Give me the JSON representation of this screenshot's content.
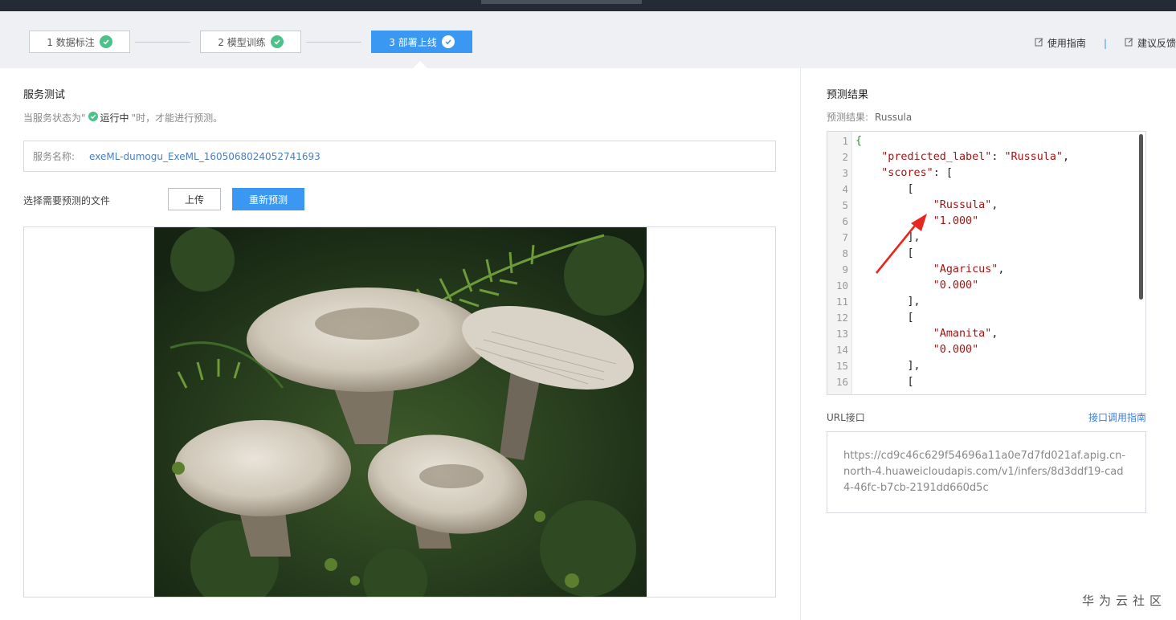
{
  "steps": [
    {
      "label": "1 数据标注",
      "active": false
    },
    {
      "label": "2 模型训练",
      "active": false
    },
    {
      "label": "3 部署上线",
      "active": true
    }
  ],
  "top_links": {
    "guide": "使用指南",
    "separator": "|",
    "feedback": "建议反馈"
  },
  "left": {
    "title": "服务测试",
    "hint_prefix": "当服务状态为\"",
    "hint_status": "运行中",
    "hint_suffix": "\"时，才能进行预测。",
    "service_name_label": "服务名称:",
    "service_name_value": "exeML-dumogu_ExeML_1605068024052741693",
    "pick_label": "选择需要预测的文件",
    "upload_button": "上传",
    "repredict_button": "重新预测"
  },
  "right": {
    "title": "预测结果",
    "result_label": "预测结果:",
    "result_value": "Russula",
    "code_lines": [
      {
        "n": "1",
        "parts": [
          {
            "t": "{",
            "c": "brace"
          }
        ]
      },
      {
        "n": "2",
        "parts": [
          {
            "t": "    ",
            "c": ""
          },
          {
            "t": "\"predicted_label\"",
            "c": "str"
          },
          {
            "t": ": ",
            "c": ""
          },
          {
            "t": "\"Russula\"",
            "c": "str"
          },
          {
            "t": ",",
            "c": ""
          }
        ]
      },
      {
        "n": "3",
        "parts": [
          {
            "t": "    ",
            "c": ""
          },
          {
            "t": "\"scores\"",
            "c": "str"
          },
          {
            "t": ": [",
            "c": ""
          }
        ]
      },
      {
        "n": "4",
        "parts": [
          {
            "t": "        [",
            "c": ""
          }
        ]
      },
      {
        "n": "5",
        "parts": [
          {
            "t": "            ",
            "c": ""
          },
          {
            "t": "\"Russula\"",
            "c": "str"
          },
          {
            "t": ",",
            "c": ""
          }
        ]
      },
      {
        "n": "6",
        "parts": [
          {
            "t": "            ",
            "c": ""
          },
          {
            "t": "\"1.000\"",
            "c": "str"
          }
        ]
      },
      {
        "n": "7",
        "parts": [
          {
            "t": "        ],",
            "c": ""
          }
        ]
      },
      {
        "n": "8",
        "parts": [
          {
            "t": "        [",
            "c": ""
          }
        ]
      },
      {
        "n": "9",
        "parts": [
          {
            "t": "            ",
            "c": ""
          },
          {
            "t": "\"Agaricus\"",
            "c": "str"
          },
          {
            "t": ",",
            "c": ""
          }
        ]
      },
      {
        "n": "10",
        "parts": [
          {
            "t": "            ",
            "c": ""
          },
          {
            "t": "\"0.000\"",
            "c": "str"
          }
        ]
      },
      {
        "n": "11",
        "parts": [
          {
            "t": "        ],",
            "c": ""
          }
        ]
      },
      {
        "n": "12",
        "parts": [
          {
            "t": "        [",
            "c": ""
          }
        ]
      },
      {
        "n": "13",
        "parts": [
          {
            "t": "            ",
            "c": ""
          },
          {
            "t": "\"Amanita\"",
            "c": "str"
          },
          {
            "t": ",",
            "c": ""
          }
        ]
      },
      {
        "n": "14",
        "parts": [
          {
            "t": "            ",
            "c": ""
          },
          {
            "t": "\"0.000\"",
            "c": "str"
          }
        ]
      },
      {
        "n": "15",
        "parts": [
          {
            "t": "        ],",
            "c": ""
          }
        ]
      },
      {
        "n": "16",
        "parts": [
          {
            "t": "        [",
            "c": ""
          }
        ]
      }
    ],
    "url_label": "URL接口",
    "url_guide": "接口调用指南",
    "url_value": "https://cd9c46c629f54696a11a0e7d7fd021af.apig.cn-north-4.huaweicloudapis.com/v1/infers/8d3ddf19-cad4-46fc-b7cb-2191dd660d5c"
  },
  "watermark": "华为云社区",
  "colors": {
    "accent": "#3a98f3",
    "success": "#4cc28a",
    "annotation_arrow": "#e5281f"
  }
}
